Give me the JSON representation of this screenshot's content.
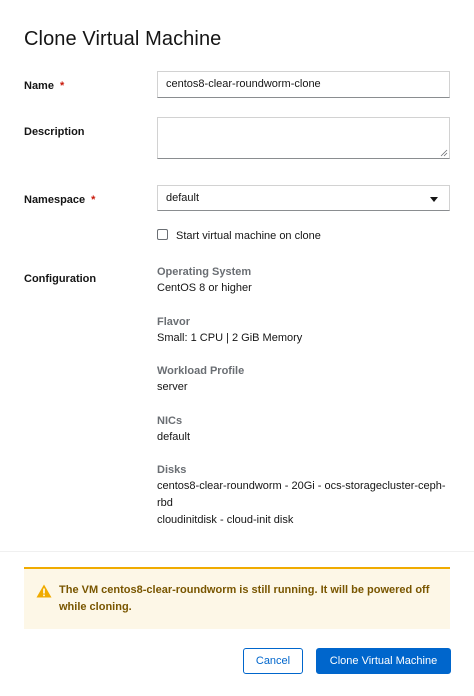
{
  "dialog": {
    "title": "Clone Virtual Machine",
    "required_marker": "*",
    "name": {
      "label": "Name",
      "value": "centos8-clear-roundworm-clone"
    },
    "description": {
      "label": "Description",
      "value": ""
    },
    "namespace": {
      "label": "Namespace",
      "selected": "default"
    },
    "start_on_clone": {
      "label": "Start virtual machine on clone",
      "checked": false
    },
    "configuration": {
      "label": "Configuration",
      "os_title": "Operating System",
      "os_value": "CentOS 8 or higher",
      "flavor_title": "Flavor",
      "flavor_value": "Small: 1 CPU | 2 GiB Memory",
      "profile_title": "Workload Profile",
      "profile_value": "server",
      "nics_title": "NICs",
      "nics_value": "default",
      "disks_title": "Disks",
      "disk_1": "centos8-clear-roundworm - 20Gi - ocs-storagecluster-ceph-rbd",
      "disk_2": "cloudinitdisk - cloud-init disk"
    },
    "alert": {
      "text": "The VM centos8-clear-roundworm is still running. It will be powered off while cloning.",
      "color": "#f0ab00"
    },
    "buttons": {
      "cancel": "Cancel",
      "submit": "Clone Virtual Machine"
    },
    "accent_color": "#0066cc"
  }
}
